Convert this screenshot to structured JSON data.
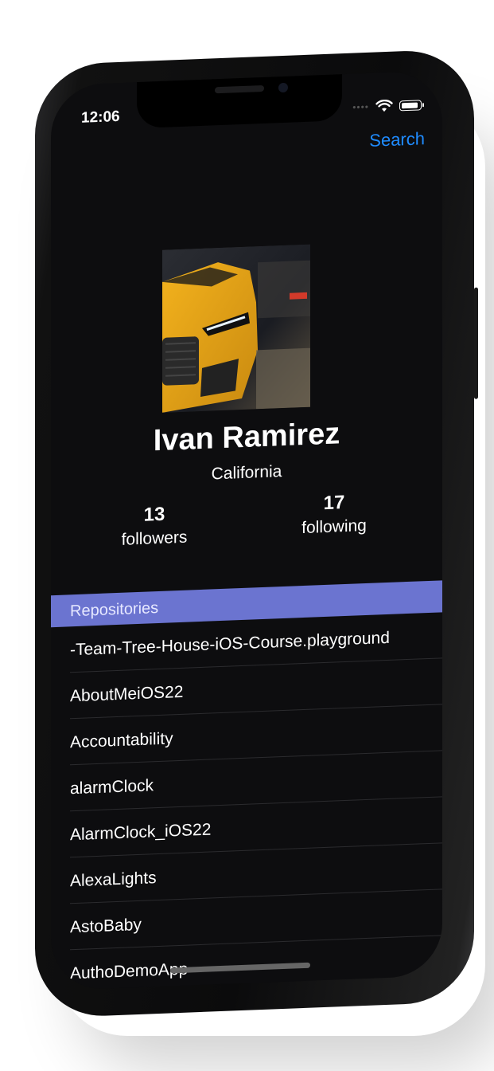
{
  "status_bar": {
    "time": "12:06"
  },
  "nav": {
    "search_label": "Search"
  },
  "profile": {
    "name": "Ivan Ramirez",
    "location": "California",
    "followers_count": "13",
    "followers_label": "followers",
    "following_count": "17",
    "following_label": "following"
  },
  "repositories": {
    "header": "Repositories",
    "items": [
      "-Team-Tree-House-iOS-Course.playground",
      "AboutMeiOS22",
      "Accountability",
      "alarmClock",
      "AlarmClock_iOS22",
      "AlexaLights",
      "AstoBaby",
      "AuthoDemoApp"
    ]
  },
  "colors": {
    "accent": "#1f8bff",
    "section_header": "#6b74d0",
    "background": "#0d0d0f"
  }
}
